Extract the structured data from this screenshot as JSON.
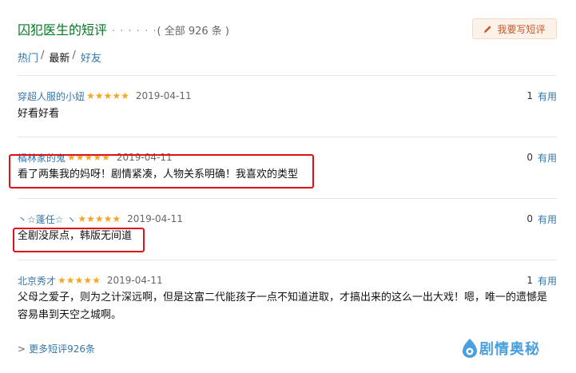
{
  "header": {
    "title": "囚犯医生的短评",
    "dots": "· · · · · ·",
    "count": "( 全部 926 条 )",
    "write_button": "我要写短评"
  },
  "tabs": [
    {
      "label": "热门",
      "sep": "/"
    },
    {
      "label": "最新",
      "sep": "/"
    },
    {
      "label": "好友",
      "sep": ""
    }
  ],
  "comments": [
    {
      "user": "穿超人服的小妞",
      "stars": 5,
      "date": "2019-04-11",
      "useful_count": "1",
      "useful_label": "有用",
      "text": "好看好看"
    },
    {
      "user": "橘林家的鬼",
      "stars": 5,
      "date": "2019-04-11",
      "useful_count": "0",
      "useful_label": "有用",
      "text": "看了两集我的妈呀！剧情紧凑，人物关系明确！我喜欢的类型"
    },
    {
      "user": "丶☆蓬任☆ ヽ",
      "stars": 5,
      "date": "2019-04-11",
      "useful_count": "0",
      "useful_label": "有用",
      "text": "全剧没尿点，韩版无间道"
    },
    {
      "user": "北京秀才",
      "stars": 5,
      "date": "2019-04-11",
      "useful_count": "1",
      "useful_label": "有用",
      "text": "父母之爱子，则为之计深远啊，但是这富二代能孩子一点不知道进取，才搞出来的这么一出大戏！嗯，唯一的遗憾是容易串到天空之城啊。"
    }
  ],
  "more": {
    "arrow": ">",
    "label": "更多短评926条"
  },
  "watermark": {
    "text": "剧情奥秘"
  },
  "colors": {
    "link": "#3377aa",
    "title": "#007722",
    "star": "#f5a623",
    "highlight": "#e0101b"
  }
}
